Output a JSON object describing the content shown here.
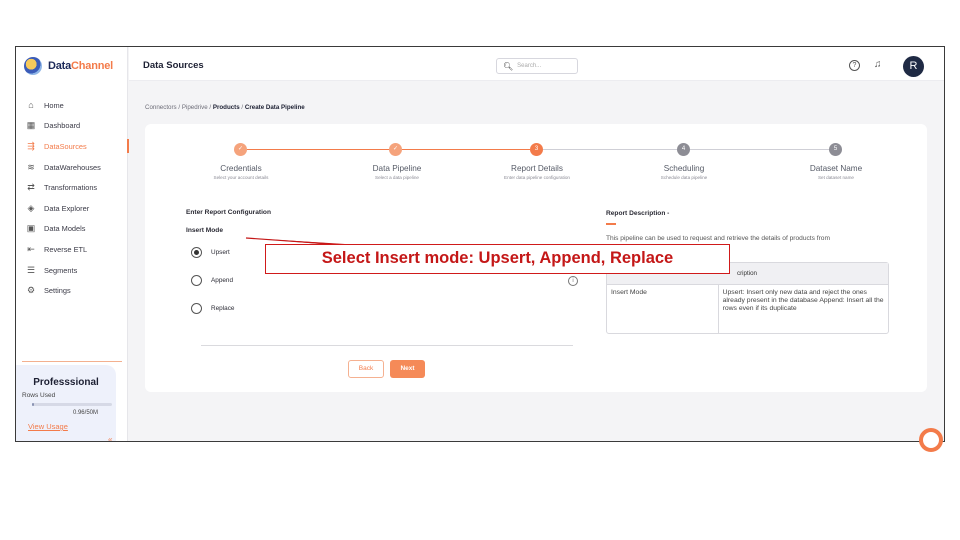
{
  "brand": {
    "name_a": "Data",
    "name_b": "Channel"
  },
  "sidebar": {
    "items": [
      {
        "label": "Home",
        "icon": "home-icon",
        "active": false
      },
      {
        "label": "Dashboard",
        "icon": "dashboard-icon",
        "active": false
      },
      {
        "label": "DataSources",
        "icon": "datasources-icon",
        "active": true
      },
      {
        "label": "DataWarehouses",
        "icon": "database-icon",
        "active": false
      },
      {
        "label": "Transformations",
        "icon": "transform-icon",
        "active": false
      },
      {
        "label": "Data Explorer",
        "icon": "explorer-icon",
        "active": false
      },
      {
        "label": "Data Models",
        "icon": "models-icon",
        "active": false
      },
      {
        "label": "Reverse ETL",
        "icon": "reverse-etl-icon",
        "active": false
      },
      {
        "label": "Segments",
        "icon": "segments-icon",
        "active": false
      },
      {
        "label": "Settings",
        "icon": "gear-icon",
        "active": false
      }
    ],
    "plan": {
      "title": "Professsional",
      "rows_label": "Rows Used",
      "rows_value": "0.96/50M",
      "rows_used_fraction": 0.0192,
      "link": "View Usage"
    }
  },
  "header": {
    "title": "Data Sources",
    "search_placeholder": "Search..."
  },
  "breadcrumb": {
    "c1": "Connectors",
    "c2": "Pipedrive",
    "c3": "Products",
    "c4": "Create Data Pipeline",
    "sep": "/"
  },
  "steps": [
    {
      "title": "Credentials",
      "sub": "Select your account details",
      "state": "done",
      "num": ""
    },
    {
      "title": "Data Pipeline",
      "sub": "Select a data pipeline",
      "state": "done",
      "num": ""
    },
    {
      "title": "Report Details",
      "sub": "Enter data pipeline configuration",
      "state": "current",
      "num": "3"
    },
    {
      "title": "Scheduling",
      "sub": "Schedule data pipeline",
      "state": "todo",
      "num": "4"
    },
    {
      "title": "Dataset Name",
      "sub": "Set dataset name",
      "state": "todo",
      "num": "5"
    }
  ],
  "config": {
    "section_title": "Enter Report Configuration",
    "insert_mode_label": "Insert Mode",
    "options": [
      {
        "label": "Upsert",
        "selected": true
      },
      {
        "label": "Append",
        "selected": false
      },
      {
        "label": "Replace",
        "selected": false
      }
    ]
  },
  "buttons": {
    "back": "Back",
    "next": "Next"
  },
  "report_desc": {
    "title": "Report Description -",
    "text": "This pipeline can be used to request and retrieve the details of products from",
    "table_header": "cription",
    "row_key": "Insert Mode",
    "row_value": "Upsert: Insert only new data and reject the ones already present in the database Append: Insert all the rows even if its duplicate"
  },
  "callout": "Select Insert mode: Upsert, Append, Replace",
  "colors": {
    "accent": "#f37b4a",
    "callout": "#d01a1a"
  }
}
